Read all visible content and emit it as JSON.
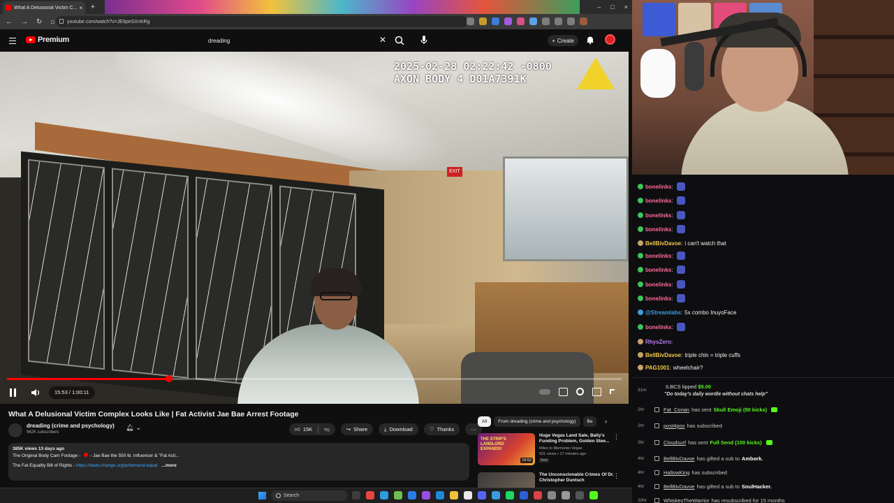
{
  "browser": {
    "tab_title": "What A Delusional Victim C...",
    "url": "youtube.com/watch?v=JE6peSXnKRg",
    "extension_colors": [
      "#7e7e7e",
      "#c79a2b",
      "#3b7dd8",
      "#a15ce0",
      "#d94f8a",
      "#5aa1e8",
      "#7e7e7e",
      "#7e7e7e",
      "#7e7e7e",
      "#9d5b3a"
    ]
  },
  "youtube": {
    "logo_text": "Premium",
    "search_value": "dreading",
    "create_label": "Create",
    "video": {
      "timestamp_line1": "2025-02-28 02:22:42 -0800",
      "timestamp_line2": "AXON BODY 4 D01A7391K",
      "exit_sign": "EXIT",
      "time": "15:53 / 1:00:11",
      "progress": 0.264
    },
    "title": "What A Delusional Victim Complex Looks Like | Fat Activist Jae Bae Arrest Footage",
    "channel": {
      "name": "dreading (crime and psychology)",
      "subscribers": "962K subscribers"
    },
    "actions": {
      "likes": "15K",
      "share": "Share",
      "download": "Download",
      "thanks": "Thanks"
    },
    "description": {
      "meta": "385K views 13 days ago",
      "line1": "The Original Body Cam Footage - ",
      "line1b": "- Jae Bae the 550 lb. Influencer & \"Fat Acti...",
      "line2": "The Fat Equality Bill of Rights - ",
      "link": "https://www.change.org/p/demand-equal",
      "more": "...more"
    },
    "chips": [
      "All",
      "From dreading (crime and psychology)",
      "Be"
    ],
    "recommendations": [
      {
        "title": "Huge Vegas Land Sale, Bally's Funding Problem, Golden Stee...",
        "channel": "Miles to Memories Vegas",
        "meta": "531 views • 17 minutes ago",
        "badge": "New",
        "duration": "18:52",
        "thumb_text": "THE STRIP'S LANDLORD EXPANDS!"
      },
      {
        "title": "The Unconscionable Crimes Of Dr. Christopher Duntsch",
        "channel": "",
        "meta": "",
        "badge": "",
        "duration": "",
        "thumb_text": ""
      }
    ]
  },
  "taskbar": {
    "search_placeholder": "Search",
    "icon_colors": [
      "#3d3d3d",
      "#e8453c",
      "#2e9be0",
      "#6fbf4f",
      "#2b7de9",
      "#9a4fe0",
      "#1e8ad6",
      "#f0c23b",
      "#e8e8e8",
      "#5865f2",
      "#3c9be0",
      "#1ed760",
      "#2e5fd8",
      "#d94343",
      "#888888",
      "#999999",
      "#555555",
      "#53fc18"
    ]
  },
  "chat": {
    "messages": [
      {
        "user": "bonelinks",
        "color": "#ff6b9a",
        "text": "",
        "emote": true,
        "badge": "#3ec45b"
      },
      {
        "user": "bonelinks",
        "color": "#ff6b9a",
        "text": "",
        "emote": true,
        "badge": "#3ec45b"
      },
      {
        "user": "bonelinks",
        "color": "#ff6b9a",
        "text": "",
        "emote": true,
        "badge": "#3ec45b"
      },
      {
        "user": "bonelinks",
        "color": "#ff6b9a",
        "text": "",
        "emote": true,
        "badge": "#3ec45b"
      },
      {
        "user": "BellBivDavoe",
        "color": "#f5c84a",
        "text": "i can't watch that",
        "emote": false,
        "badge": "#c9a36a"
      },
      {
        "user": "bonelinks",
        "color": "#ff6b9a",
        "text": "",
        "emote": true,
        "badge": "#3ec45b"
      },
      {
        "user": "bonelinks",
        "color": "#ff6b9a",
        "text": "",
        "emote": true,
        "badge": "#3ec45b"
      },
      {
        "user": "bonelinks",
        "color": "#ff6b9a",
        "text": "",
        "emote": true,
        "badge": "#3ec45b"
      },
      {
        "user": "bonelinks",
        "color": "#ff6b9a",
        "text": "",
        "emote": true,
        "badge": "#3ec45b"
      },
      {
        "user": "@Streamlabs",
        "color": "#3d9de0",
        "text": "5x  combo InuyoFace",
        "emote": true,
        "badge": "#3d9de0"
      },
      {
        "user": "bonelinks",
        "color": "#ff6b9a",
        "text": "",
        "emote": true,
        "badge": "#3ec45b"
      },
      {
        "user": "RhysZero",
        "color": "#b97cf0",
        "text": "",
        "emote": false,
        "badge": "#c9a36a"
      },
      {
        "user": "BellBivDavoe",
        "color": "#f5c84a",
        "text": "triple chin = triple cuffs",
        "emote": false,
        "badge": "#c9a36a"
      },
      {
        "user": "PAG1001",
        "color": "#f5c84a",
        "text": "wheelchair?",
        "emote": false,
        "badge": "#c9a36a"
      }
    ]
  },
  "events": {
    "tip": {
      "time": "31m",
      "user": "ILBCS",
      "action": "tipped",
      "amount": "$5.00",
      "message": "\"Do today's daily wordle without chats help\""
    },
    "items": [
      {
        "time": "2hr",
        "user": "Fat_Conan",
        "pre": "has sent",
        "highlight": "Skull Emoji (50 kicks)",
        "target": "",
        "kick": true
      },
      {
        "time": "2hr",
        "user": "post4pox",
        "pre": "has subscribed",
        "highlight": "",
        "target": "",
        "kick": false
      },
      {
        "time": "3hr",
        "user": "Cloudsurf",
        "pre": "has sent",
        "highlight": "Full Send (100 kicks)",
        "target": "",
        "kick": true
      },
      {
        "time": "4hr",
        "user": "BellBivDavoe",
        "pre": "has gifted a sub to",
        "highlight": "",
        "target": "Ambork.",
        "kick": false
      },
      {
        "time": "4hr",
        "user": "HallowKing",
        "pre": "has subscribed",
        "highlight": "",
        "target": "",
        "kick": false
      },
      {
        "time": "4hr",
        "user": "BellBivDavoe",
        "pre": "has gifted a sub to",
        "highlight": "",
        "target": "SoulHacker.",
        "kick": false
      },
      {
        "time": "20hr",
        "user": "WhiskeyTheWarrior",
        "pre": "has resubscribed for 15 months",
        "highlight": "",
        "target": "",
        "kick": false
      }
    ]
  }
}
